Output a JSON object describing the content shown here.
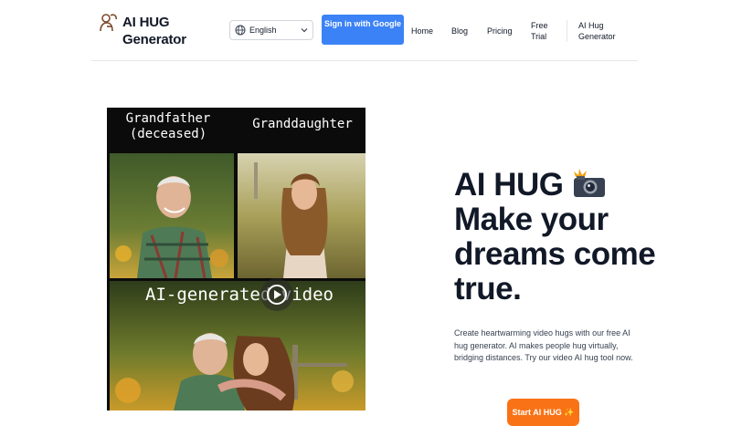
{
  "header": {
    "logo_text": "AI HUG Generator",
    "language": {
      "selected": "English",
      "icon": "globe-icon"
    },
    "signin_label": "Sign in with Google",
    "nav": [
      "Home",
      "Blog",
      "Pricing",
      "Free Trial",
      "AI Hug Generator"
    ]
  },
  "hero_image": {
    "caption_left": "Grandfather (deceased)",
    "caption_right": "Granddaughter",
    "caption_bottom": "AI-generated video",
    "play_icon": "play-icon"
  },
  "hero": {
    "headline": "AI HUG",
    "headline_emoji": "camera-flash-icon",
    "headline_rest": "Make your dreams come true.",
    "description": "Create heartwarming video hugs with our free AI hug generator. AI makes people hug virtually, bridging distances. Try our video AI hug tool now.",
    "cta_label": "Start AI HUG ✨"
  },
  "colors": {
    "accent_blue": "#3b82f6",
    "cta_orange": "#f97316",
    "text": "#111827"
  }
}
